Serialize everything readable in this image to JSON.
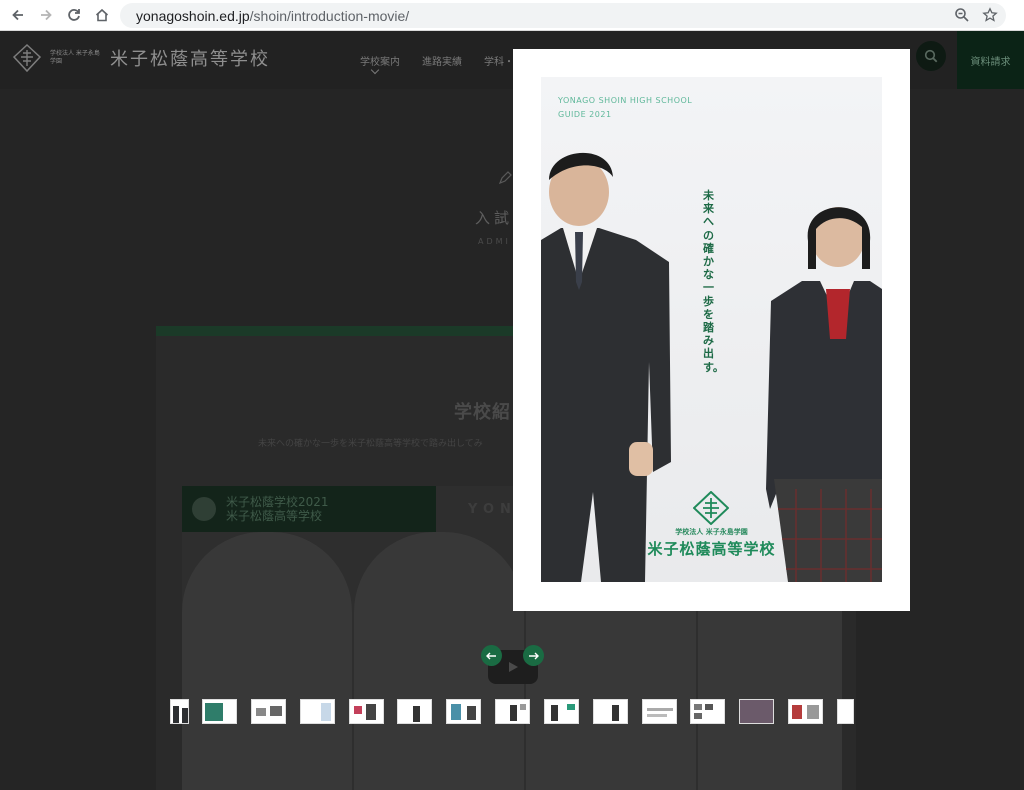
{
  "browser": {
    "url_domain": "yonagoshoin.ed.jp",
    "url_path": "/shoin/introduction-movie/",
    "icons": [
      "back-icon",
      "forward-icon",
      "reload-icon",
      "home-icon",
      "zoom-icon",
      "bookmark-star-icon"
    ]
  },
  "site": {
    "logo_sub": "学校法人 米子永島学園",
    "logo_name": "米子松蔭高等学校",
    "nav": [
      "学校案内",
      "進路実績",
      "学科・"
    ],
    "request_label": "資料請求",
    "exam_title": "入試",
    "exam_sub": "ADMI",
    "intro_title": "学校紹",
    "intro_desc": "未来への確かな一歩を米子松蔭高等学校で踏み出してみ",
    "video_bar_line1": "米子松蔭学校2021",
    "video_bar_line2": "米子松蔭高等学校",
    "video_yonago": "YONA"
  },
  "lightbox": {
    "cover_en_line1": "YONAGO SHOIN HIGH SCHOOL",
    "cover_en_line2": "GUIDE 2021",
    "tagline": "未来への確かな一歩を踏み出す。",
    "corp": "学校法人 米子永島学園",
    "school_name": "米子松蔭高等学校",
    "prev_label": "previous-arrow",
    "next_label": "next-arrow",
    "thumbnails": 15
  },
  "colors": {
    "brand_green": "#1a6b43",
    "cover_green": "#1f8a5a",
    "overlay": "#1f1f1f"
  }
}
